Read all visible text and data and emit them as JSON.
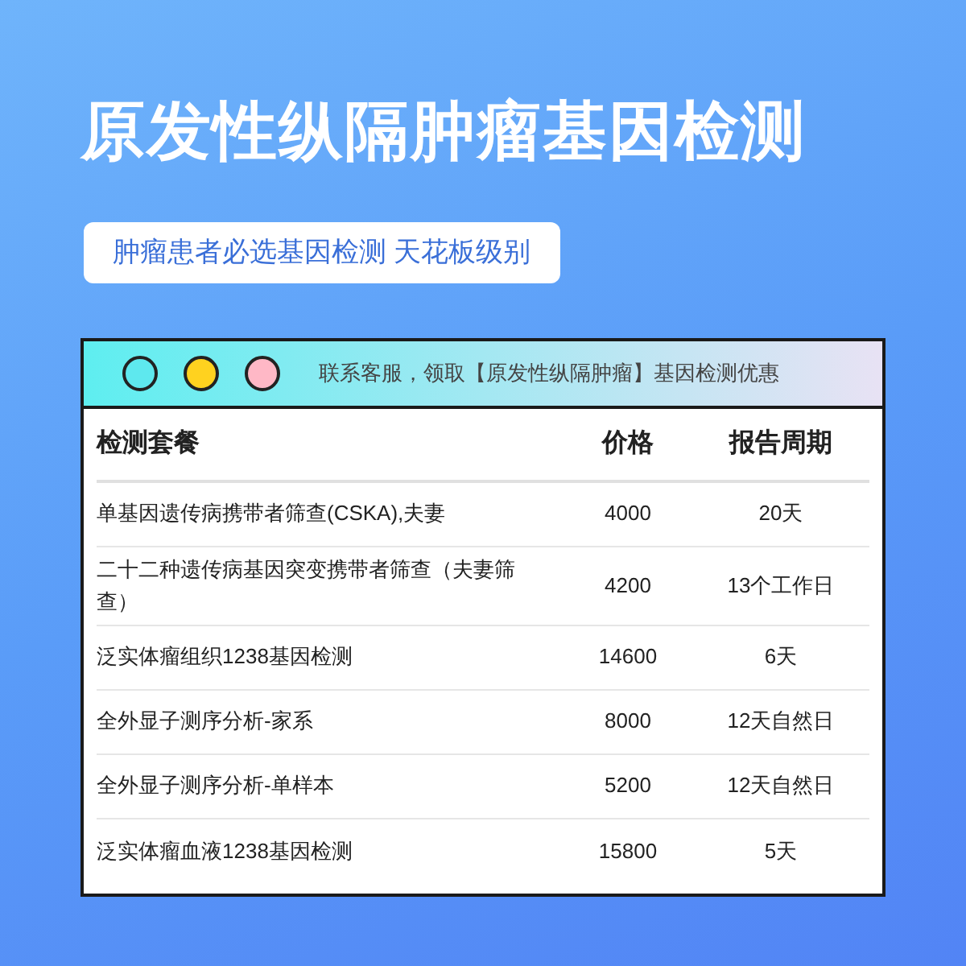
{
  "title": "原发性纵隔肿瘤基因检测",
  "subtitle": "肿瘤患者必选基因检测 天花板级别",
  "window": {
    "dots": [
      {
        "color": "#5ee8ee"
      },
      {
        "color": "#ffd21f"
      },
      {
        "color": "#ffb8c6"
      }
    ],
    "notice": "联系客服，领取【原发性纵隔肿瘤】基因检测优惠"
  },
  "table": {
    "columns": [
      "检测套餐",
      "价格",
      "报告周期"
    ],
    "rows": [
      [
        "单基因遗传病携带者筛查(CSKA),夫妻",
        "4000",
        "20天"
      ],
      [
        "二十二种遗传病基因突变携带者筛查（夫妻筛查）",
        "4200",
        "13个工作日"
      ],
      [
        "泛实体瘤组织1238基因检测",
        "14600",
        "6天"
      ],
      [
        "全外显子测序分析-家系",
        "8000",
        "12天自然日"
      ],
      [
        "全外显子测序分析-单样本",
        "5200",
        "12天自然日"
      ],
      [
        "泛实体瘤血液1238基因检测",
        "15800",
        "5天"
      ]
    ]
  }
}
